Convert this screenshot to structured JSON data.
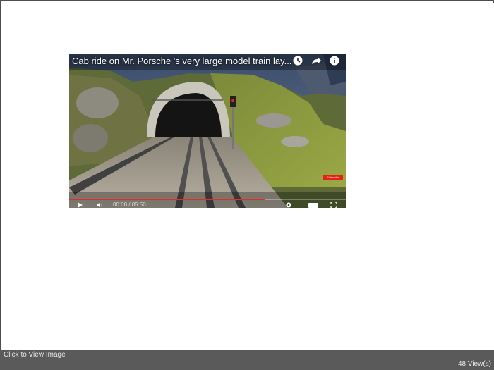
{
  "video": {
    "title": "Cab ride on Mr. Porsche 's very large model train lay...",
    "time_display": "00:00 / 05:50",
    "progress_fraction": 0.71,
    "subscribe_label": "Subscribe",
    "icons": [
      "clock-icon",
      "share-icon",
      "info-icon",
      "play-icon",
      "volume-icon",
      "settings-icon",
      "hd-icon",
      "fullscreen-icon"
    ],
    "progress_color": "#e52d27"
  },
  "footer": {
    "click_to_view": "Click to View Image",
    "views": "48 View(s)"
  }
}
